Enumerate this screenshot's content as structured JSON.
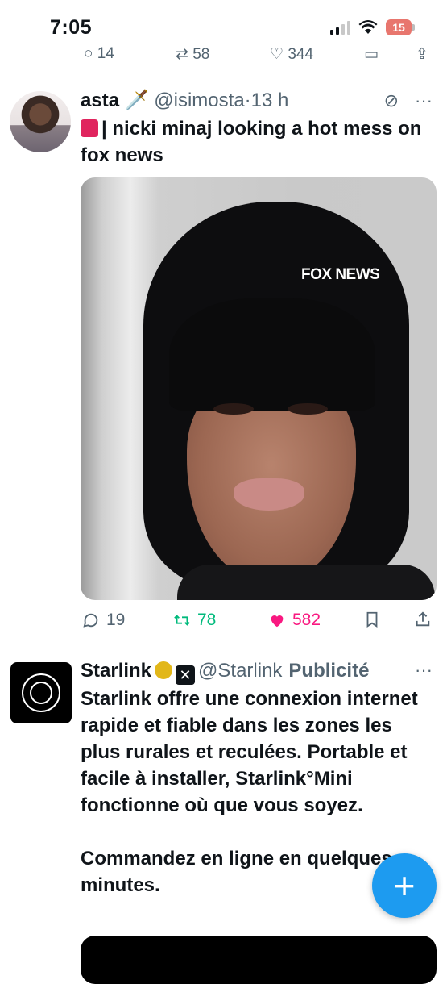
{
  "status_bar": {
    "time": "7:05",
    "battery": "15"
  },
  "previous_tweet_actions": {
    "replies": "14",
    "retweets": "58",
    "likes": "344"
  },
  "tweet": {
    "author_name": "asta",
    "author_emoji": "🗡️",
    "handle": "@isimosta",
    "separator": "·",
    "time": "13 h",
    "text": "| nicki minaj looking a hot mess on fox news",
    "media_watermark": "FOX NEWS",
    "actions": {
      "replies": "19",
      "retweets": "78",
      "likes": "582"
    },
    "more_label": "···"
  },
  "ad": {
    "name": "Starlink",
    "handle": "@Starlink",
    "promoted_label": "Publicité",
    "more_label": "···",
    "text_para_1": "Starlink offre une connexion internet rapide et fiable dans les zones les plus rurales et reculées. Portable et facile à installer, Starlink°Mini fonctionne où que vous soyez.",
    "text_para_2": "Commandez en ligne en quelques minutes."
  },
  "fab": {
    "label": "+"
  },
  "colors": {
    "accent": "#1d9bf0",
    "retweet": "#00ba7c",
    "like": "#f91880",
    "muted": "#536471"
  }
}
